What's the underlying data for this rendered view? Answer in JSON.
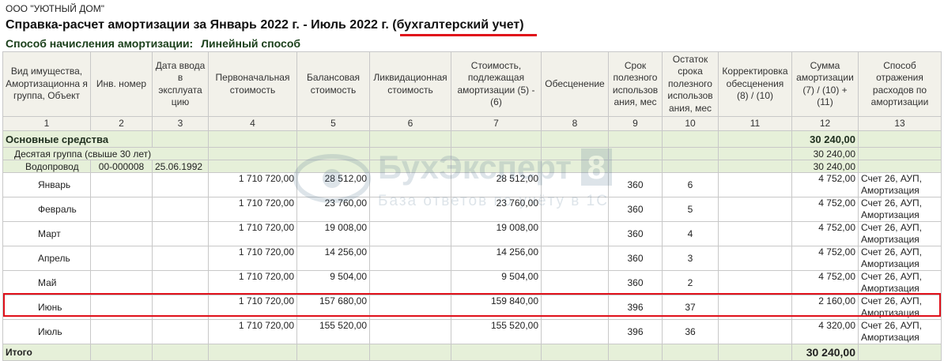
{
  "header": {
    "org": "ООО \"УЮТНЫЙ ДОМ\"",
    "title": "Справка-расчет амортизации за Январь 2022 г. - Июль 2022 г. (бухгалтерский учет)",
    "method_label": "Способ начисления амортизации:",
    "method_value": "Линейный способ"
  },
  "columns": [
    {
      "label": "Вид имущества, Амортизационна я группа, Объект",
      "num": "1"
    },
    {
      "label": "Инв. номер",
      "num": "2"
    },
    {
      "label": "Дата ввода в эксплуата цию",
      "num": "3"
    },
    {
      "label": "Первоначальная стоимость",
      "num": "4"
    },
    {
      "label": "Балансовая стоимость",
      "num": "5"
    },
    {
      "label": "Ликвидационная стоимость",
      "num": "6"
    },
    {
      "label": "Стоимость, подлежащая амортизации (5) - (6)",
      "num": "7"
    },
    {
      "label": "Обесценение",
      "num": "8"
    },
    {
      "label": "Срок полезного использов ания, мес",
      "num": "9"
    },
    {
      "label": "Остаток срока полезного использов ания, мес",
      "num": "10"
    },
    {
      "label": "Корректировка обесценения (8) / (10)",
      "num": "11"
    },
    {
      "label": "Сумма амортизации (7) / (10) + (11)",
      "num": "12"
    },
    {
      "label": "Способ отражения расходов по амортизации",
      "num": "13"
    }
  ],
  "groups": {
    "g0": {
      "name": "Основные средства",
      "sum": "30 240,00"
    },
    "g1": {
      "name": "Десятая группа (свыше 30 лет)",
      "sum": "30 240,00"
    },
    "g2": {
      "name": "Водопровод",
      "inv": "00-000008",
      "date": "25.06.1992",
      "sum": "30 240,00"
    }
  },
  "months": [
    {
      "name": "Январь",
      "initial": "1 710 720,00",
      "balance": "28 512,00",
      "depreciable": "28 512,00",
      "life": "360",
      "remaining": "6",
      "amount": "4 752,00",
      "method": "Счет 26, АУП, Амортизация"
    },
    {
      "name": "Февраль",
      "initial": "1 710 720,00",
      "balance": "23 760,00",
      "depreciable": "23 760,00",
      "life": "360",
      "remaining": "5",
      "amount": "4 752,00",
      "method": "Счет 26, АУП, Амортизация"
    },
    {
      "name": "Март",
      "initial": "1 710 720,00",
      "balance": "19 008,00",
      "depreciable": "19 008,00",
      "life": "360",
      "remaining": "4",
      "amount": "4 752,00",
      "method": "Счет 26, АУП, Амортизация"
    },
    {
      "name": "Апрель",
      "initial": "1 710 720,00",
      "balance": "14 256,00",
      "depreciable": "14 256,00",
      "life": "360",
      "remaining": "3",
      "amount": "4 752,00",
      "method": "Счет 26, АУП, Амортизация"
    },
    {
      "name": "Май",
      "initial": "1 710 720,00",
      "balance": "9 504,00",
      "depreciable": "9 504,00",
      "life": "360",
      "remaining": "2",
      "amount": "4 752,00",
      "method": "Счет 26, АУП, Амортизация"
    },
    {
      "name": "Июнь",
      "initial": "1 710 720,00",
      "balance": "157 680,00",
      "depreciable": "159 840,00",
      "life": "396",
      "remaining": "37",
      "amount": "2 160,00",
      "method": "Счет 26, АУП, Амортизация"
    },
    {
      "name": "Июль",
      "initial": "1 710 720,00",
      "balance": "155 520,00",
      "depreciable": "155 520,00",
      "life": "396",
      "remaining": "36",
      "amount": "4 320,00",
      "method": "Счет 26, АУП, Амортизация"
    }
  ],
  "total": {
    "label": "Итого",
    "sum": "30 240,00"
  },
  "watermark": {
    "brand": "БухЭксперт",
    "digit": "8",
    "sub": "База ответов по учёту в 1С"
  },
  "colors": {
    "accent": "#e0101a",
    "group_bg": "#e6f0d9",
    "header_bg": "#f2f1ea"
  }
}
